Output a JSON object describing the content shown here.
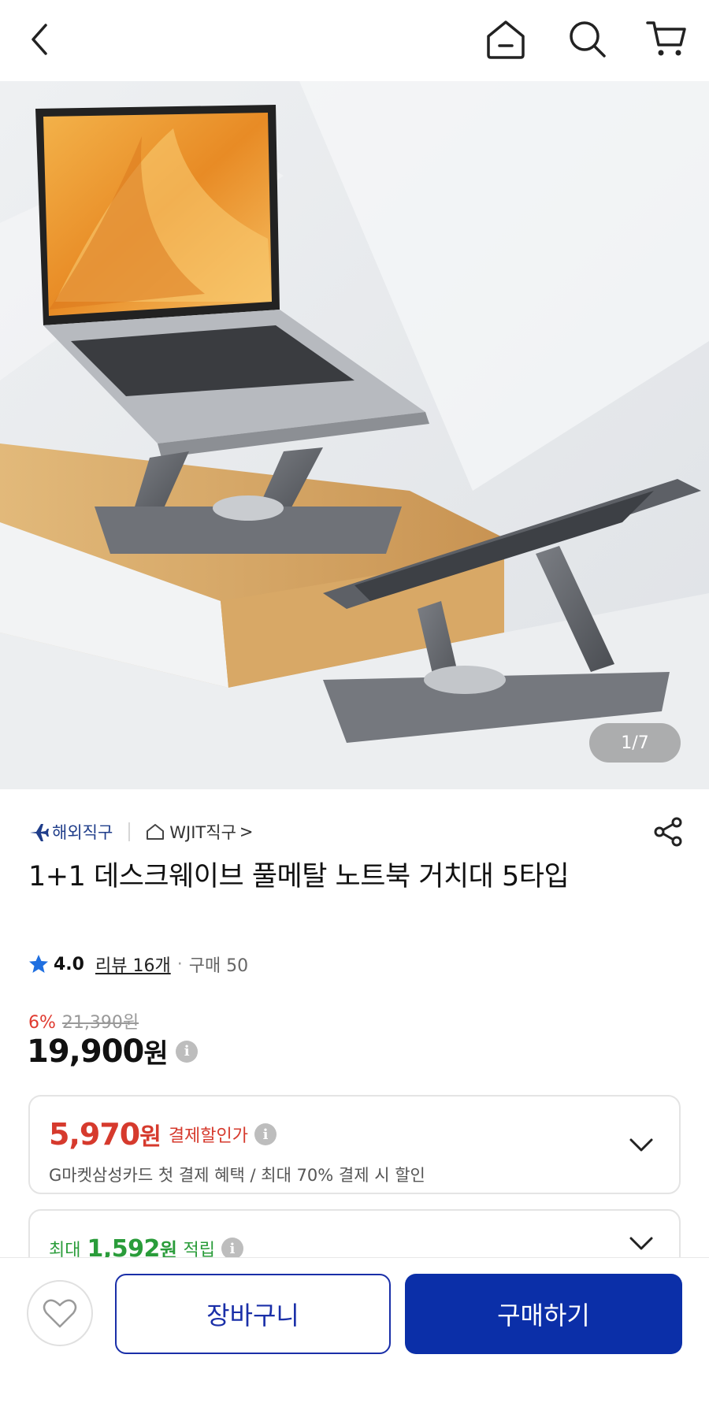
{
  "header": {
    "back_icon": "chevron-left-icon",
    "home_icon": "home-icon",
    "search_icon": "search-icon",
    "cart_icon": "cart-icon"
  },
  "gallery": {
    "counter": "1/7"
  },
  "seller": {
    "badge_label": "해외직구",
    "store_name": "WJIT직구",
    "store_arrow": ">"
  },
  "product": {
    "title": "1+1 데스크웨이브 풀메탈 노트북 거치대 5타입"
  },
  "rating": {
    "score": "4.0",
    "review_label": "리뷰 16개",
    "dot": "·",
    "purchase_label": "구매 50"
  },
  "pricing": {
    "discount_rate": "6%",
    "original_price": "21,390원",
    "price_number": "19,900",
    "price_unit": "원",
    "info": "i"
  },
  "payment_discount": {
    "price_number": "5,970",
    "price_unit": "원",
    "label": "결제할인가",
    "info": "i",
    "description": "G마켓삼성카드 첫 결제 혜택 / 최대 70% 결제 시 할인"
  },
  "reward": {
    "prefix": "최대",
    "amount_number": "1,592",
    "amount_unit": "원",
    "suffix": "적립",
    "info": "i"
  },
  "actions": {
    "wishlist_icon": "heart-icon",
    "cart_label": "장바구니",
    "buy_label": "구매하기"
  },
  "colors": {
    "primary": "#0b2fa8",
    "discount_red": "#d63a2d",
    "reward_green": "#2a9c3a"
  }
}
